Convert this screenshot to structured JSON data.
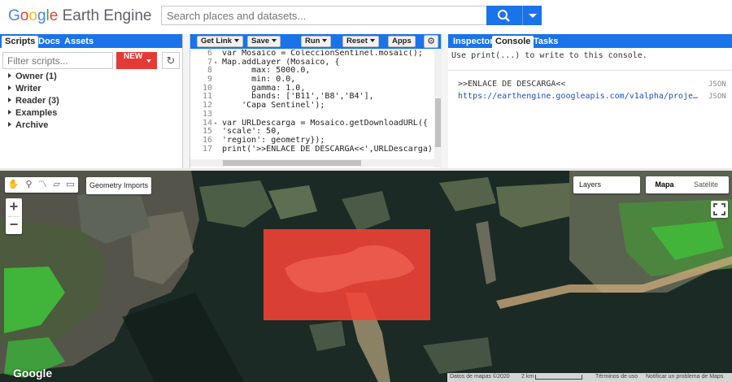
{
  "header": {
    "logo_google": [
      "G",
      "o",
      "o",
      "g",
      "l",
      "e"
    ],
    "logo_product": "Earth Engine",
    "search_placeholder": "Search places and datasets..."
  },
  "left_panel": {
    "tabs": [
      "Scripts",
      "Docs",
      "Assets"
    ],
    "active_tab": "Scripts",
    "filter_placeholder": "Filter scripts...",
    "new_label": "NEW",
    "tree": [
      "Owner (1)",
      "Writer",
      "Reader (3)",
      "Examples",
      "Archive"
    ]
  },
  "editor": {
    "buttons": [
      "Get Link",
      "Save",
      "Run",
      "Reset",
      "Apps"
    ],
    "lines": [
      {
        "n": "6",
        "fold": "",
        "code": "var Mosaico = ColeccionSentinel.mosaic();"
      },
      {
        "n": "7",
        "fold": "▾",
        "code": "Map.addLayer (Mosaico, {"
      },
      {
        "n": "8",
        "fold": "",
        "code": "      max: 5000.0,"
      },
      {
        "n": "9",
        "fold": "",
        "code": "      min: 0.0,"
      },
      {
        "n": "10",
        "fold": "",
        "code": "      gamma: 1.0,"
      },
      {
        "n": "11",
        "fold": "",
        "code": "      bands: ['B11','B8','B4'],"
      },
      {
        "n": "12",
        "fold": "",
        "code": "    'Capa Sentinel');"
      },
      {
        "n": "13",
        "fold": "",
        "code": ""
      },
      {
        "n": "14",
        "fold": "▾",
        "code": "var URLDescarga = Mosaico.getDownloadURL({"
      },
      {
        "n": "15",
        "fold": "",
        "code": "'scale': 50,"
      },
      {
        "n": "16",
        "fold": "",
        "code": "'region': geometry});"
      },
      {
        "n": "17",
        "fold": "",
        "code": "print('>>ENLACE DE DESCARGA<<',URLDescarga);"
      }
    ]
  },
  "right_panel": {
    "tabs": [
      "Inspector",
      "Console",
      "Tasks"
    ],
    "active_tab": "Console",
    "hint": "Use print(...) to write to this console.",
    "entries": [
      {
        "text": ">>ENLACE DE DESCARGA<<",
        "type": "JSON"
      },
      {
        "text": "https://earthengine.googleapis.com/v1alpha/proje…",
        "type": "JSON"
      }
    ]
  },
  "map": {
    "geometry_imports": "Geometry Imports",
    "zoom_in": "+",
    "zoom_out": "−",
    "layers": "Layers",
    "map_types": [
      "Mapa",
      "Satélite"
    ],
    "active_map_type": "Mapa",
    "google_logo": "Google",
    "footer": {
      "data": "Datos de mapas ©2020",
      "scale": "2 km",
      "terms": "Términos de uso",
      "report": "Notificar un problema de Maps"
    },
    "colors": {
      "region": "#f44336",
      "water": "#1b2a24",
      "vegetation": "#3fc43a"
    }
  }
}
